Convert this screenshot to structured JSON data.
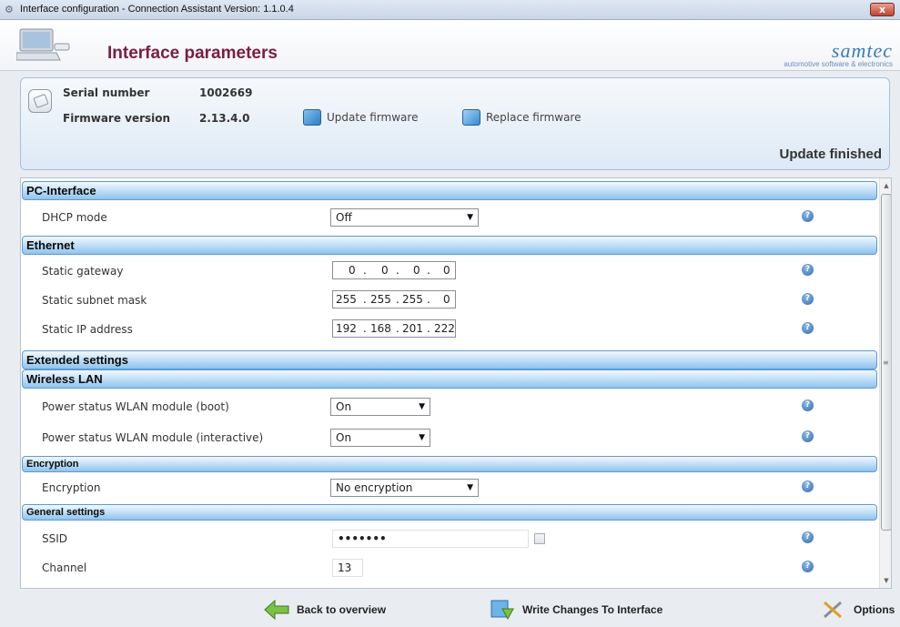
{
  "window": {
    "title": "Interface configuration - Connection Assistant Version: 1.1.0.4",
    "close": "x"
  },
  "header": {
    "title": "Interface parameters",
    "logo_brand": "samtec",
    "logo_tagline": "automotive software & electronics"
  },
  "device": {
    "serial_label": "Serial number",
    "serial_value": "1002669",
    "firmware_label": "Firmware version",
    "firmware_value": "2.13.4.0",
    "update_firmware": "Update firmware",
    "replace_firmware": "Replace firmware",
    "status": "Update finished"
  },
  "sections": {
    "pc_interface": "PC-Interface",
    "ethernet": "Ethernet",
    "extended": "Extended settings",
    "wlan": "Wireless LAN",
    "encryption": "Encryption",
    "general": "General settings"
  },
  "fields": {
    "dhcp": {
      "label": "DHCP mode",
      "value": "Off"
    },
    "gateway": {
      "label": "Static gateway",
      "octets": [
        "0",
        "0",
        "0",
        "0"
      ]
    },
    "subnet": {
      "label": "Static subnet mask",
      "octets": [
        "255",
        "255",
        "255",
        "0"
      ]
    },
    "ip": {
      "label": "Static IP address",
      "octets": [
        "192",
        "168",
        "201",
        "222"
      ]
    },
    "wlan_boot": {
      "label": "Power status WLAN module (boot)",
      "value": "On"
    },
    "wlan_inter": {
      "label": "Power status WLAN module (interactive)",
      "value": "On"
    },
    "encryption": {
      "label": "Encryption",
      "value": "No encryption"
    },
    "ssid": {
      "label": "SSID",
      "value": "•••••••"
    },
    "channel": {
      "label": "Channel",
      "value": "13"
    }
  },
  "footer": {
    "back": "Back to overview",
    "write": "Write Changes To Interface",
    "options": "Options"
  },
  "colors": {
    "title_accent": "#7a1f3d",
    "section_blue": "#8ec3ee",
    "help_blue": "#2f6aa8"
  }
}
